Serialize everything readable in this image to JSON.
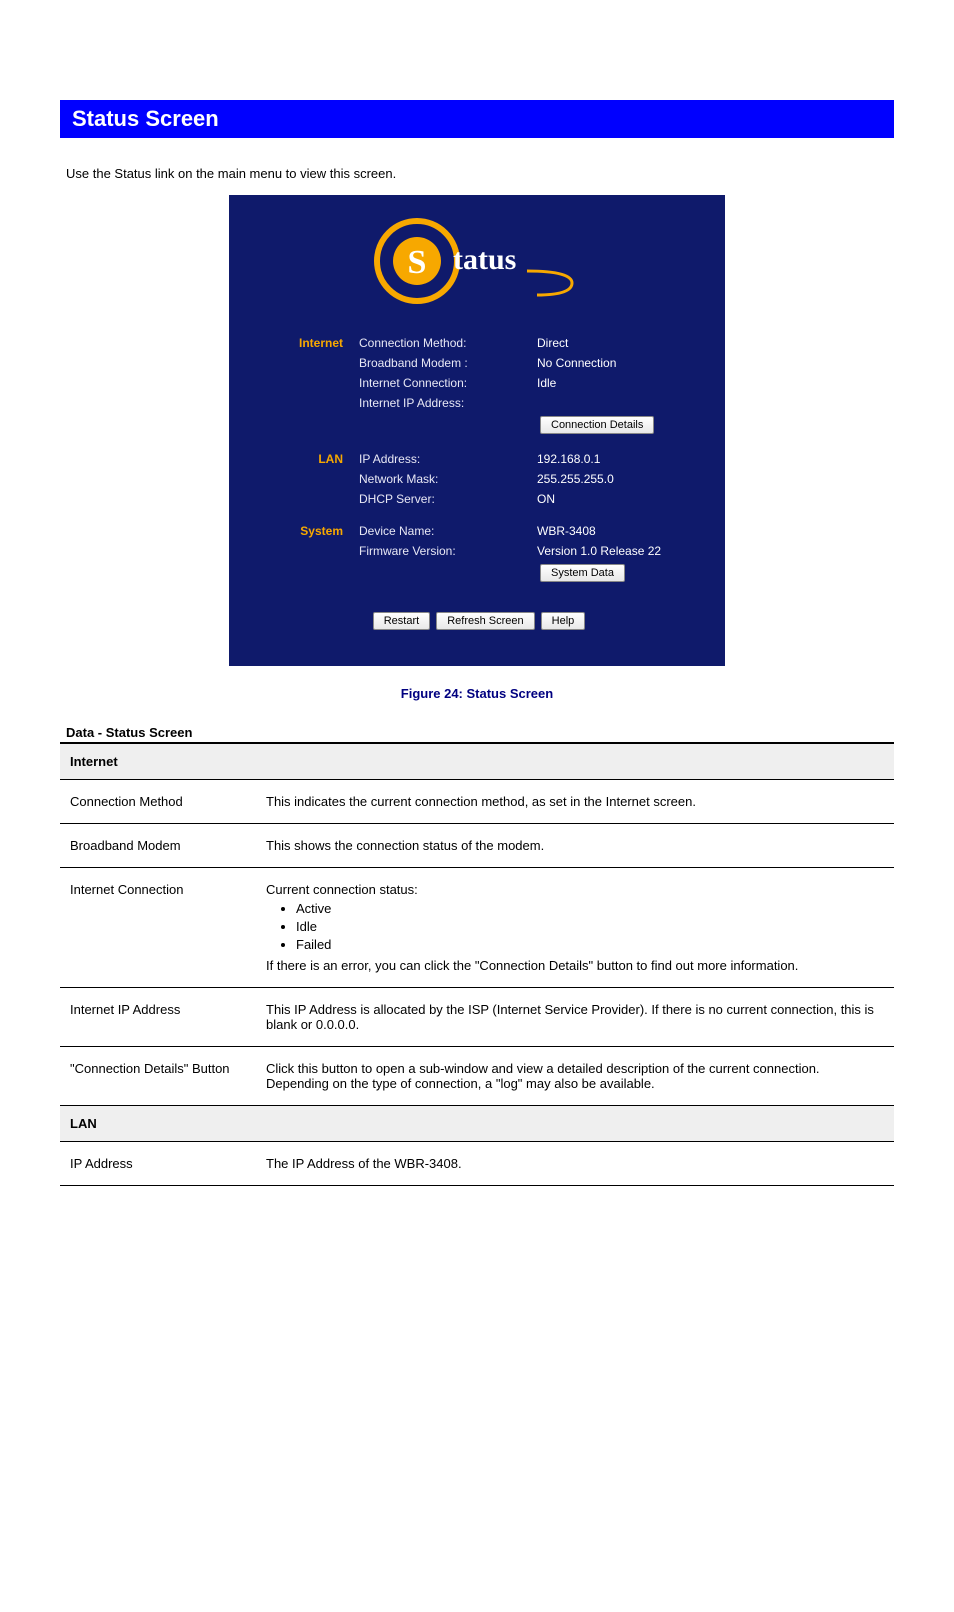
{
  "title": "Status Screen",
  "intro": "Use the Status link on the main menu to view this screen.",
  "status_panel": {
    "logo_text": "tatus",
    "sections": [
      {
        "name": "Internet",
        "rows": [
          {
            "label": "Connection Method:",
            "value": "Direct"
          },
          {
            "label": "Broadband Modem :",
            "value": "No Connection"
          },
          {
            "label": "Internet Connection:",
            "value": "Idle"
          },
          {
            "label": "Internet IP Address:",
            "value": ""
          }
        ],
        "button": "Connection Details"
      },
      {
        "name": "LAN",
        "rows": [
          {
            "label": "IP Address:",
            "value": "192.168.0.1"
          },
          {
            "label": "Network Mask:",
            "value": "255.255.255.0"
          },
          {
            "label": "DHCP Server:",
            "value": "ON"
          }
        ]
      },
      {
        "name": "System",
        "rows": [
          {
            "label": "Device Name:",
            "value": "WBR-3408"
          },
          {
            "label": "Firmware Version:",
            "value": "Version 1.0 Release 22"
          }
        ],
        "button": "System Data"
      }
    ],
    "bottom_buttons": [
      "Restart",
      "Refresh Screen",
      "Help"
    ]
  },
  "caption": "Figure 24: Status Screen",
  "table_heading": "Data - Status Screen",
  "groups": [
    {
      "name": "Internet",
      "rows": [
        {
          "term": "Connection Method",
          "desc": "This indicates the current connection method, as set in the Internet screen."
        },
        {
          "term": "Broadband Modem",
          "desc": "This shows the connection status of the modem."
        },
        {
          "term": "Internet Connection",
          "desc_lead": "Current connection status:",
          "bullets": [
            "Active",
            "Idle",
            "Failed"
          ],
          "note": "If there is an error, you can click the \"Connection Details\" button to find out more information."
        },
        {
          "term": "Internet IP Address",
          "desc": "This IP Address is allocated by the ISP (Internet Service Provider). If there is no current connection, this is blank or 0.0.0.0."
        },
        {
          "term": "\"Connection Details\" Button",
          "desc": "Click this button to open a sub-window and view a detailed description of the current connection. Depending on the type of connection, a \"log\" may also be available."
        }
      ]
    },
    {
      "name": "LAN",
      "rows": [
        {
          "term": "IP Address",
          "desc": "The IP Address of the WBR-3408."
        }
      ]
    }
  ]
}
